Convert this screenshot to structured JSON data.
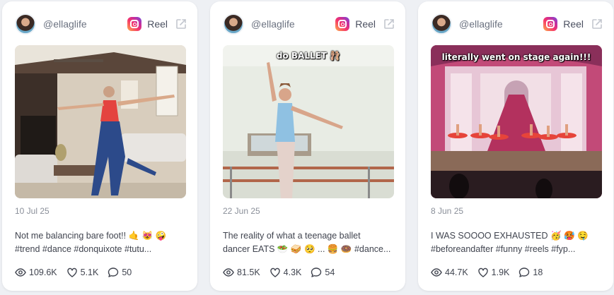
{
  "cards": [
    {
      "handle": "@ellaglife",
      "platform_label": "Reel",
      "date": "10 Jul 25",
      "overlay": "",
      "caption_line1": "Not me balancing bare foot!! 🤙 😻 🤪",
      "caption_line2": "#trend #dance #donquixote #tutu...",
      "views": "109.6K",
      "likes": "5.1K",
      "comments": "50"
    },
    {
      "handle": "@ellaglife",
      "platform_label": "Reel",
      "date": "22 Jun 25",
      "overlay": "do BALLET 🩰",
      "caption_line1": "The reality of what a teenage ballet",
      "caption_line2": "dancer EATS 🥗 🥪 🥺 ... 🍔 🍩  #dance...",
      "views": "81.5K",
      "likes": "4.3K",
      "comments": "54"
    },
    {
      "handle": "@ellaglife",
      "platform_label": "Reel",
      "date": "8 Jun 25",
      "overlay": "literally went on stage again!!!",
      "caption_line1": "I WAS SOOOO EXHAUSTED 🥳 🥵 🤤",
      "caption_line2": "#beforeandafter #funny #reels #fyp...",
      "views": "44.7K",
      "likes": "1.9K",
      "comments": "18"
    }
  ],
  "icons": {
    "platform": "instagram-icon",
    "external": "external-link-icon",
    "views": "eye-icon",
    "likes": "heart-icon",
    "comments": "comment-icon"
  },
  "colors": {
    "background": "#eef0f4",
    "card": "#ffffff",
    "muted_text": "#8a8f99"
  }
}
